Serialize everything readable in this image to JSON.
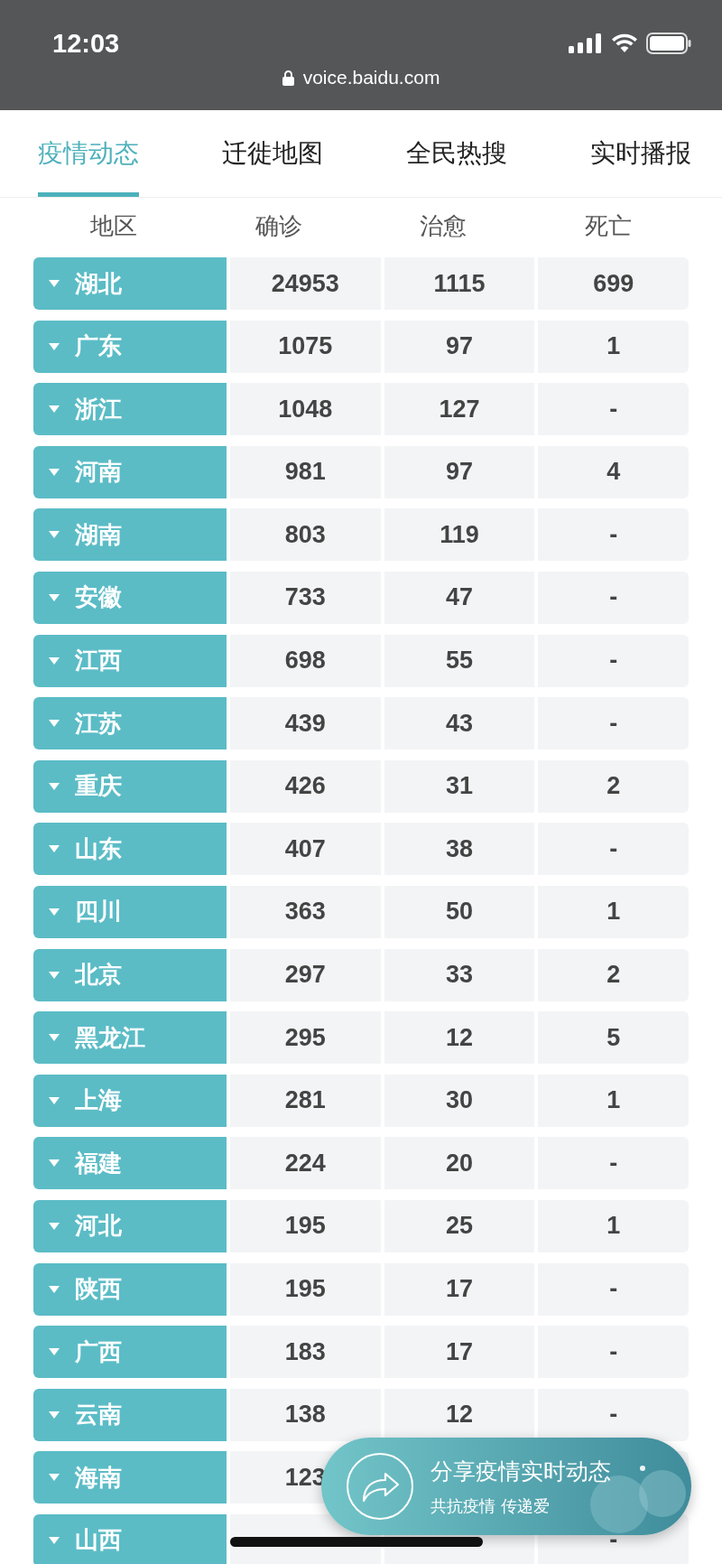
{
  "status_bar": {
    "time": "12:03",
    "url": "voice.baidu.com"
  },
  "tabs": [
    {
      "label": "疫情动态",
      "selected": true
    },
    {
      "label": "迁徙地图",
      "selected": false
    },
    {
      "label": "全民热搜",
      "selected": false
    },
    {
      "label": "实时播报",
      "selected": false
    }
  ],
  "table": {
    "columns": [
      "地区",
      "确诊",
      "治愈",
      "死亡"
    ],
    "rows": [
      {
        "region": "湖北",
        "expanded": false,
        "confirmed": "24953",
        "cured": "1115",
        "deaths": "699"
      },
      {
        "region": "广东",
        "expanded": false,
        "confirmed": "1075",
        "cured": "97",
        "deaths": "1"
      },
      {
        "region": "浙江",
        "expanded": false,
        "confirmed": "1048",
        "cured": "127",
        "deaths": "-"
      },
      {
        "region": "河南",
        "expanded": false,
        "confirmed": "981",
        "cured": "97",
        "deaths": "4"
      },
      {
        "region": "湖南",
        "expanded": false,
        "confirmed": "803",
        "cured": "119",
        "deaths": "-"
      },
      {
        "region": "安徽",
        "expanded": false,
        "confirmed": "733",
        "cured": "47",
        "deaths": "-"
      },
      {
        "region": "江西",
        "expanded": false,
        "confirmed": "698",
        "cured": "55",
        "deaths": "-"
      },
      {
        "region": "江苏",
        "expanded": false,
        "confirmed": "439",
        "cured": "43",
        "deaths": "-"
      },
      {
        "region": "重庆",
        "expanded": false,
        "confirmed": "426",
        "cured": "31",
        "deaths": "2"
      },
      {
        "region": "山东",
        "expanded": false,
        "confirmed": "407",
        "cured": "38",
        "deaths": "-"
      },
      {
        "region": "四川",
        "expanded": false,
        "confirmed": "363",
        "cured": "50",
        "deaths": "1"
      },
      {
        "region": "北京",
        "expanded": false,
        "confirmed": "297",
        "cured": "33",
        "deaths": "2"
      },
      {
        "region": "黑龙江",
        "expanded": false,
        "confirmed": "295",
        "cured": "12",
        "deaths": "5"
      },
      {
        "region": "上海",
        "expanded": false,
        "confirmed": "281",
        "cured": "30",
        "deaths": "1"
      },
      {
        "region": "福建",
        "expanded": false,
        "confirmed": "224",
        "cured": "20",
        "deaths": "-"
      },
      {
        "region": "河北",
        "expanded": false,
        "confirmed": "195",
        "cured": "25",
        "deaths": "1"
      },
      {
        "region": "陕西",
        "expanded": false,
        "confirmed": "195",
        "cured": "17",
        "deaths": "-"
      },
      {
        "region": "广西",
        "expanded": false,
        "confirmed": "183",
        "cured": "17",
        "deaths": "-"
      },
      {
        "region": "云南",
        "expanded": false,
        "confirmed": "138",
        "cured": "12",
        "deaths": "-"
      },
      {
        "region": "海南",
        "expanded": false,
        "confirmed": "123"
      },
      {
        "region": "山西",
        "expanded": false,
        "deaths": "-"
      }
    ]
  },
  "share_card": {
    "title": "分享疫情实时动态",
    "subtitle": "共抗疫情 传递爱"
  }
}
